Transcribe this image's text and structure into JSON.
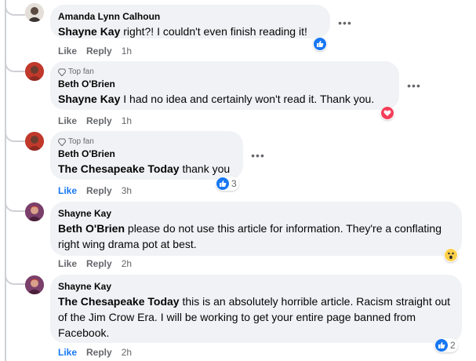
{
  "actions": {
    "like": "Like",
    "reply": "Reply"
  },
  "comments": [
    {
      "author": "Amanda Lynn Calhoun",
      "badge": "",
      "mention": "Shayne Kay",
      "text": " right?! I couldn't even finish reading it!",
      "time": "1h",
      "reaction": {
        "type": "like",
        "count": ""
      }
    },
    {
      "author": "Beth O'Brien",
      "badge": "Top fan",
      "mention": "Shayne Kay",
      "text": " I had no idea and certainly won't read it. Thank you.",
      "time": "1h",
      "reaction": {
        "type": "love",
        "count": ""
      }
    },
    {
      "author": "Beth O'Brien",
      "badge": "Top fan",
      "mention": "The Chesapeake Today",
      "text": " thank you",
      "time": "3h",
      "liked": true,
      "reaction": {
        "type": "like",
        "count": "3"
      }
    },
    {
      "author": "Shayne Kay",
      "badge": "",
      "mention": "Beth O'Brien",
      "text": " please do not use this article for information. They're a conflating right wing drama pot at best.",
      "time": "2h",
      "reaction": {
        "type": "wow",
        "count": ""
      }
    },
    {
      "author": "Shayne Kay",
      "badge": "",
      "mention": "The Chesapeake Today",
      "text": " this is an absolutely horrible article. Racism straight out of the Jim Crow Era. I will be working to get your entire page banned from Facebook.",
      "time": "2h",
      "reaction": {
        "type": "like",
        "count": "2"
      }
    }
  ],
  "colors": {
    "bubble": "#f0f2f5",
    "link_blue": "#1877f2",
    "meta_gray": "#65676b",
    "love": "#f33e58",
    "wow": "#fcd04c"
  }
}
